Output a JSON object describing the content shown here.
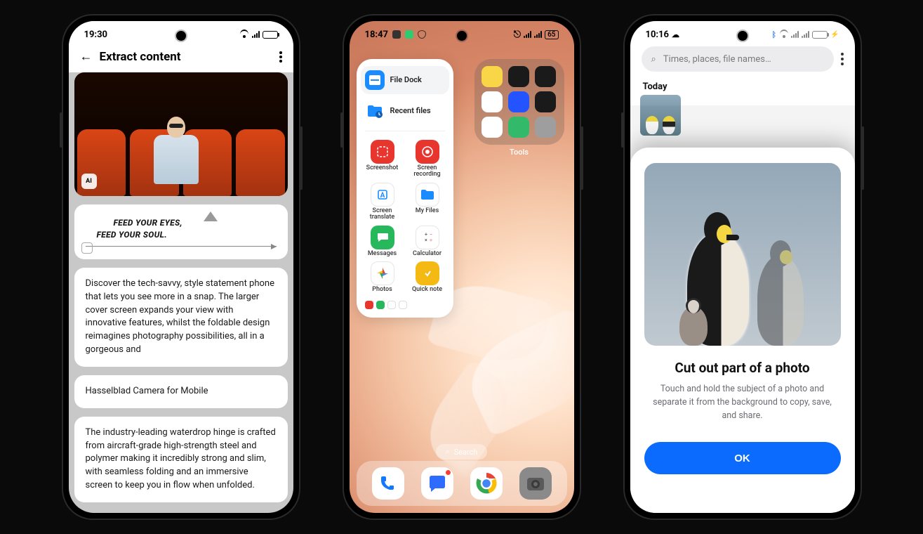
{
  "phone1": {
    "status": {
      "time": "19:30"
    },
    "header": {
      "title": "Extract content",
      "ai_badge": "AI"
    },
    "promo": {
      "line1": "FEED YOUR EYES,",
      "line2": "FEED YOUR SOUL."
    },
    "cards": {
      "body1": "Discover the tech-savvy, style statement phone that lets you see more in a snap. The larger cover screen expands your view with innovative features, whilst the foldable design reimagines photography possibilities, all in a gorgeous and",
      "body2": "Hasselblad Camera for Mobile",
      "body3": "The industry-leading waterdrop hinge is crafted from aircraft-grade high-strength steel and polymer making it incredibly strong and slim, with seamless folding and an immersive screen to keep you in flow when unfolded."
    }
  },
  "phone2": {
    "status": {
      "time": "18:47",
      "battery": "65"
    },
    "sidebar": {
      "file_dock": "File Dock",
      "recent_files": "Recent files",
      "screenshot": "Screenshot",
      "screen_recording": "Screen recording",
      "screen_translate": "Screen translate",
      "my_files": "My Files",
      "messages": "Messages",
      "calculator": "Calculator",
      "photos": "Photos",
      "quick_note": "Quick note"
    },
    "folder_label": "Tools",
    "search": {
      "label": "Search"
    }
  },
  "phone3": {
    "status": {
      "time": "10:16"
    },
    "search": {
      "placeholder": "Times, places, file names…"
    },
    "section": "Today",
    "sheet": {
      "title": "Cut out part of a photo",
      "desc": "Touch and hold the subject of a photo and separate it from the background to copy, save, and share.",
      "ok": "OK"
    }
  }
}
